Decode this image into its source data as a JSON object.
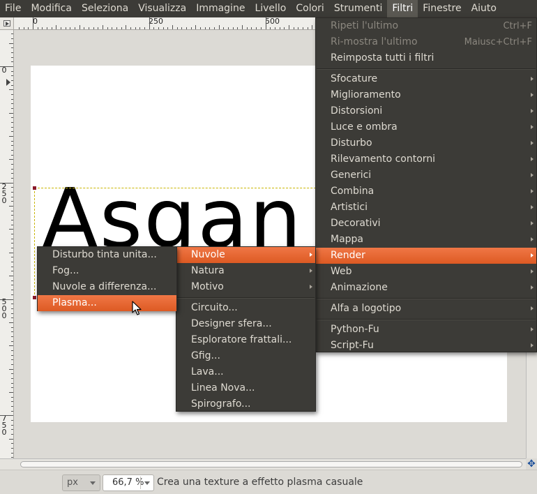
{
  "menubar": {
    "items": [
      {
        "label": "File"
      },
      {
        "label": "Modifica"
      },
      {
        "label": "Seleziona"
      },
      {
        "label": "Visualizza"
      },
      {
        "label": "Immagine"
      },
      {
        "label": "Livello"
      },
      {
        "label": "Colori"
      },
      {
        "label": "Strumenti"
      },
      {
        "label": "Filtri",
        "active": true
      },
      {
        "label": "Finestre"
      },
      {
        "label": "Aiuto"
      }
    ]
  },
  "rulers": {
    "h_labels": [
      "0",
      "250",
      "500"
    ],
    "v_labels": [
      "0",
      "250",
      "500",
      "750"
    ]
  },
  "canvas": {
    "text": "Asgan"
  },
  "filters_menu": {
    "repeat_last": {
      "label": "Ripeti l'ultimo",
      "accel": "Ctrl+F"
    },
    "reshow_last": {
      "label": "Ri-mostra l'ultimo",
      "accel": "Maiusc+Ctrl+F"
    },
    "reset_all": {
      "label": "Reimposta tutti i filtri"
    },
    "items": [
      {
        "label": "Sfocature"
      },
      {
        "label": "Miglioramento"
      },
      {
        "label": "Distorsioni"
      },
      {
        "label": "Luce e ombra"
      },
      {
        "label": "Disturbo"
      },
      {
        "label": "Rilevamento contorni"
      },
      {
        "label": "Generici"
      },
      {
        "label": "Combina"
      },
      {
        "label": "Artistici"
      },
      {
        "label": "Decorativi"
      },
      {
        "label": "Mappa"
      },
      {
        "label": "Render",
        "active": true
      },
      {
        "label": "Web"
      },
      {
        "label": "Animazione"
      }
    ],
    "alpha_to_logo": {
      "label": "Alfa a logotipo"
    },
    "python_fu": {
      "label": "Python-Fu"
    },
    "script_fu": {
      "label": "Script-Fu"
    }
  },
  "render_menu": {
    "items": [
      {
        "label": "Nuvole",
        "active": true
      },
      {
        "label": "Natura"
      },
      {
        "label": "Motivo"
      }
    ],
    "plugins": [
      {
        "label": "Circuito..."
      },
      {
        "label": "Designer sfera..."
      },
      {
        "label": "Esploratore frattali..."
      },
      {
        "label": "Gfig..."
      },
      {
        "label": "Lava..."
      },
      {
        "label": "Linea Nova..."
      },
      {
        "label": "Spirografo..."
      }
    ]
  },
  "clouds_menu": {
    "items": [
      {
        "label": "Disturbo tinta unita..."
      },
      {
        "label": "Fog..."
      },
      {
        "label": "Nuvole a differenza..."
      },
      {
        "label": "Plasma...",
        "active": true
      }
    ]
  },
  "statusbar": {
    "unit": "px",
    "zoom": "66,7 %",
    "message": "Crea una texture a effetto plasma casuale"
  },
  "colors": {
    "menu_bg": "#3c3b37",
    "highlight": "#e8682e",
    "menu_text": "#dfdbd2",
    "disabled_text": "#8b877f"
  }
}
